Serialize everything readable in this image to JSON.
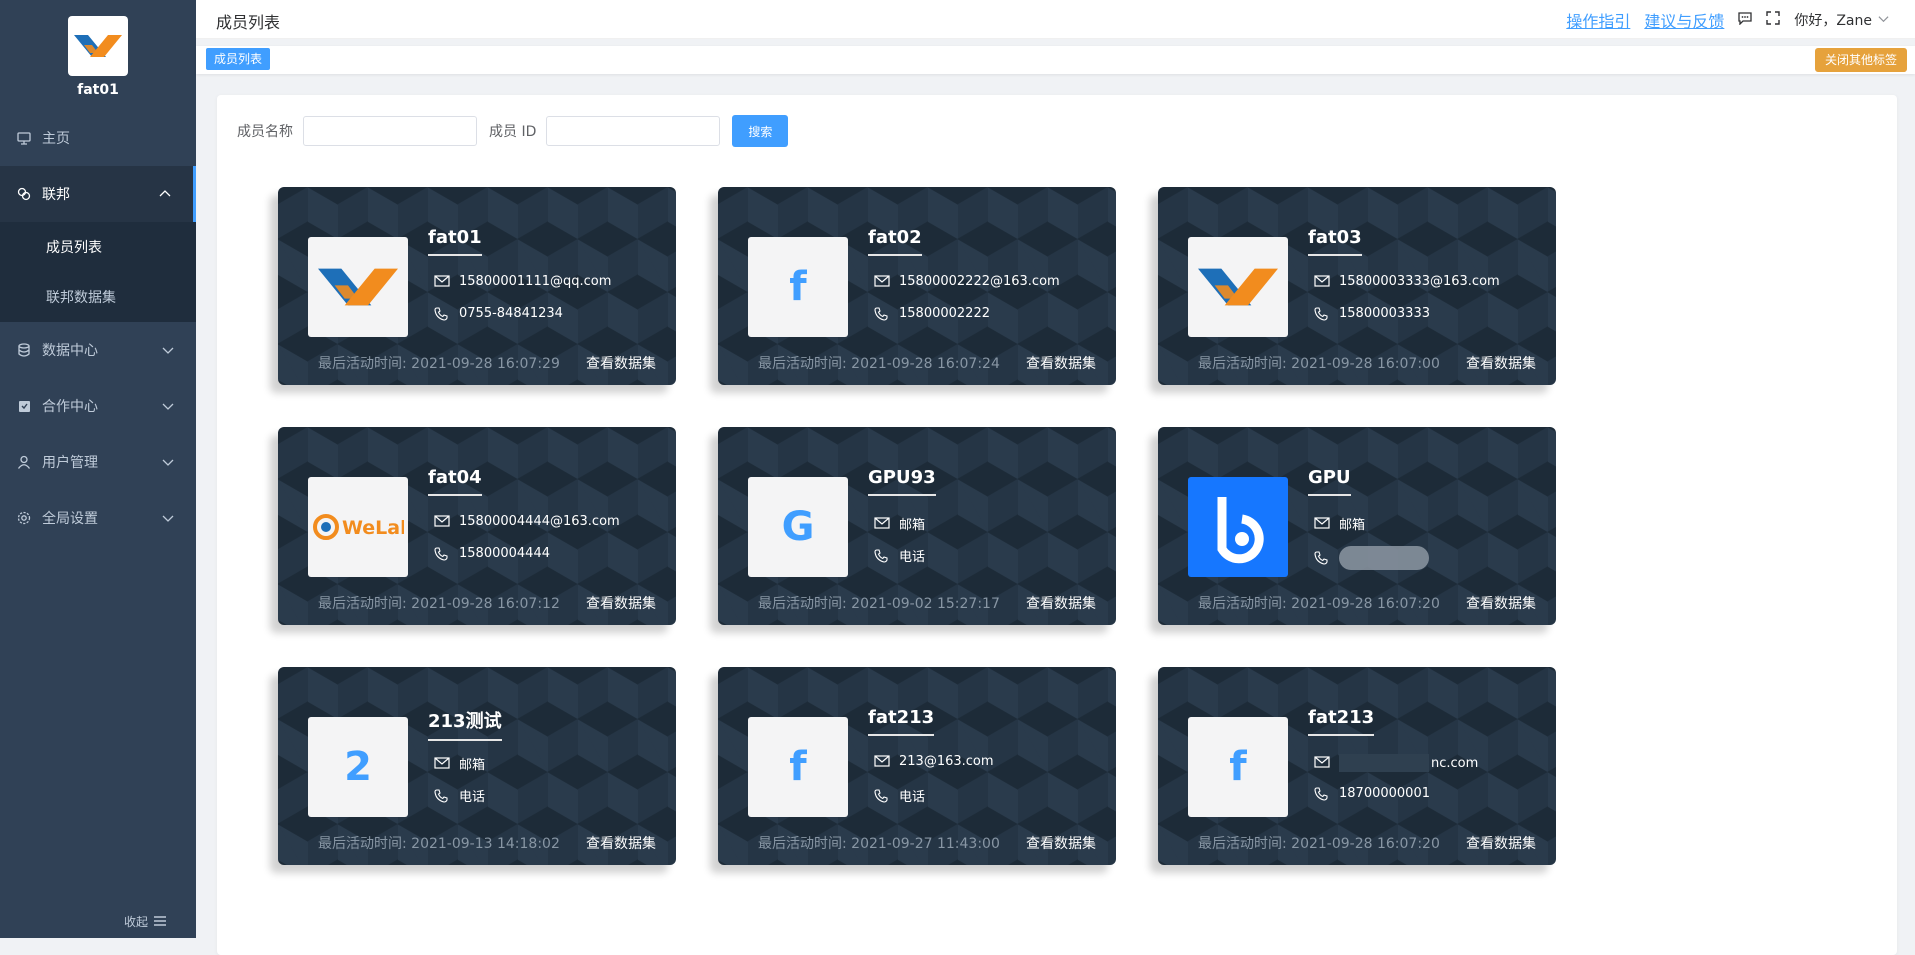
{
  "app": {
    "org_name": "fat01"
  },
  "sidebar": {
    "items": [
      {
        "label": "主页",
        "icon": "monitor-icon"
      },
      {
        "label": "联邦",
        "icon": "link-icon",
        "open": true,
        "children": [
          {
            "label": "成员列表",
            "active": true
          },
          {
            "label": "联邦数据集"
          }
        ]
      },
      {
        "label": "数据中心",
        "icon": "database-icon"
      },
      {
        "label": "合作中心",
        "icon": "clipboard-icon"
      },
      {
        "label": "用户管理",
        "icon": "user-icon"
      },
      {
        "label": "全局设置",
        "icon": "gear-icon"
      }
    ],
    "collapse_label": "收起"
  },
  "header": {
    "title": "成员列表",
    "guide_link": "操作指引",
    "feedback_link": "建议与反馈",
    "greeting": "你好，Zane"
  },
  "tags": {
    "active": "成员列表",
    "close_others": "关闭其他标签"
  },
  "search": {
    "name_label": "成员名称",
    "id_label": "成员 ID",
    "name_value": "",
    "id_value": "",
    "button": "搜索"
  },
  "card_common": {
    "last_active_prefix": "最后活动时间: ",
    "view_datasets": "查看数据集"
  },
  "members": [
    {
      "name": "fat01",
      "logo": "x-logo",
      "email": "15800001111@qq.com",
      "phone": "0755-84841234",
      "last_active": "2021-09-28 16:07:29"
    },
    {
      "name": "fat02",
      "logo": "f",
      "email": "15800002222@163.com",
      "phone": "15800002222",
      "last_active": "2021-09-28 16:07:24"
    },
    {
      "name": "fat03",
      "logo": "x-logo",
      "email": "15800003333@163.com",
      "phone": "15800003333",
      "last_active": "2021-09-28 16:07:00"
    },
    {
      "name": "fat04",
      "logo": "welab-logo",
      "email": "15800004444@163.com",
      "phone": "15800004444",
      "last_active": "2021-09-28 16:07:12"
    },
    {
      "name": "GPU93",
      "logo": "G",
      "email": "邮箱",
      "phone": "电话",
      "last_active": "2021-09-02 15:27:17"
    },
    {
      "name": "GPU",
      "logo": "b-logo",
      "email": "邮箱",
      "phone": "",
      "last_active": "2021-09-28 16:07:20"
    },
    {
      "name": "213测试",
      "logo": "2",
      "email": "邮箱",
      "phone": "电话",
      "last_active": "2021-09-13 14:18:02"
    },
    {
      "name": "fat213",
      "logo": "f",
      "email": "213@163.com",
      "phone": "电话",
      "last_active": "2021-09-27 11:43:00"
    },
    {
      "name": "fat213",
      "logo": "f",
      "email": "nc.com",
      "phone": "18700000001",
      "last_active": "2021-09-28 16:07:20"
    }
  ],
  "colors": {
    "sidebar_bg": "#304156",
    "accent": "#409eff",
    "warning": "#e6a23c",
    "card_bg": "#253545"
  }
}
